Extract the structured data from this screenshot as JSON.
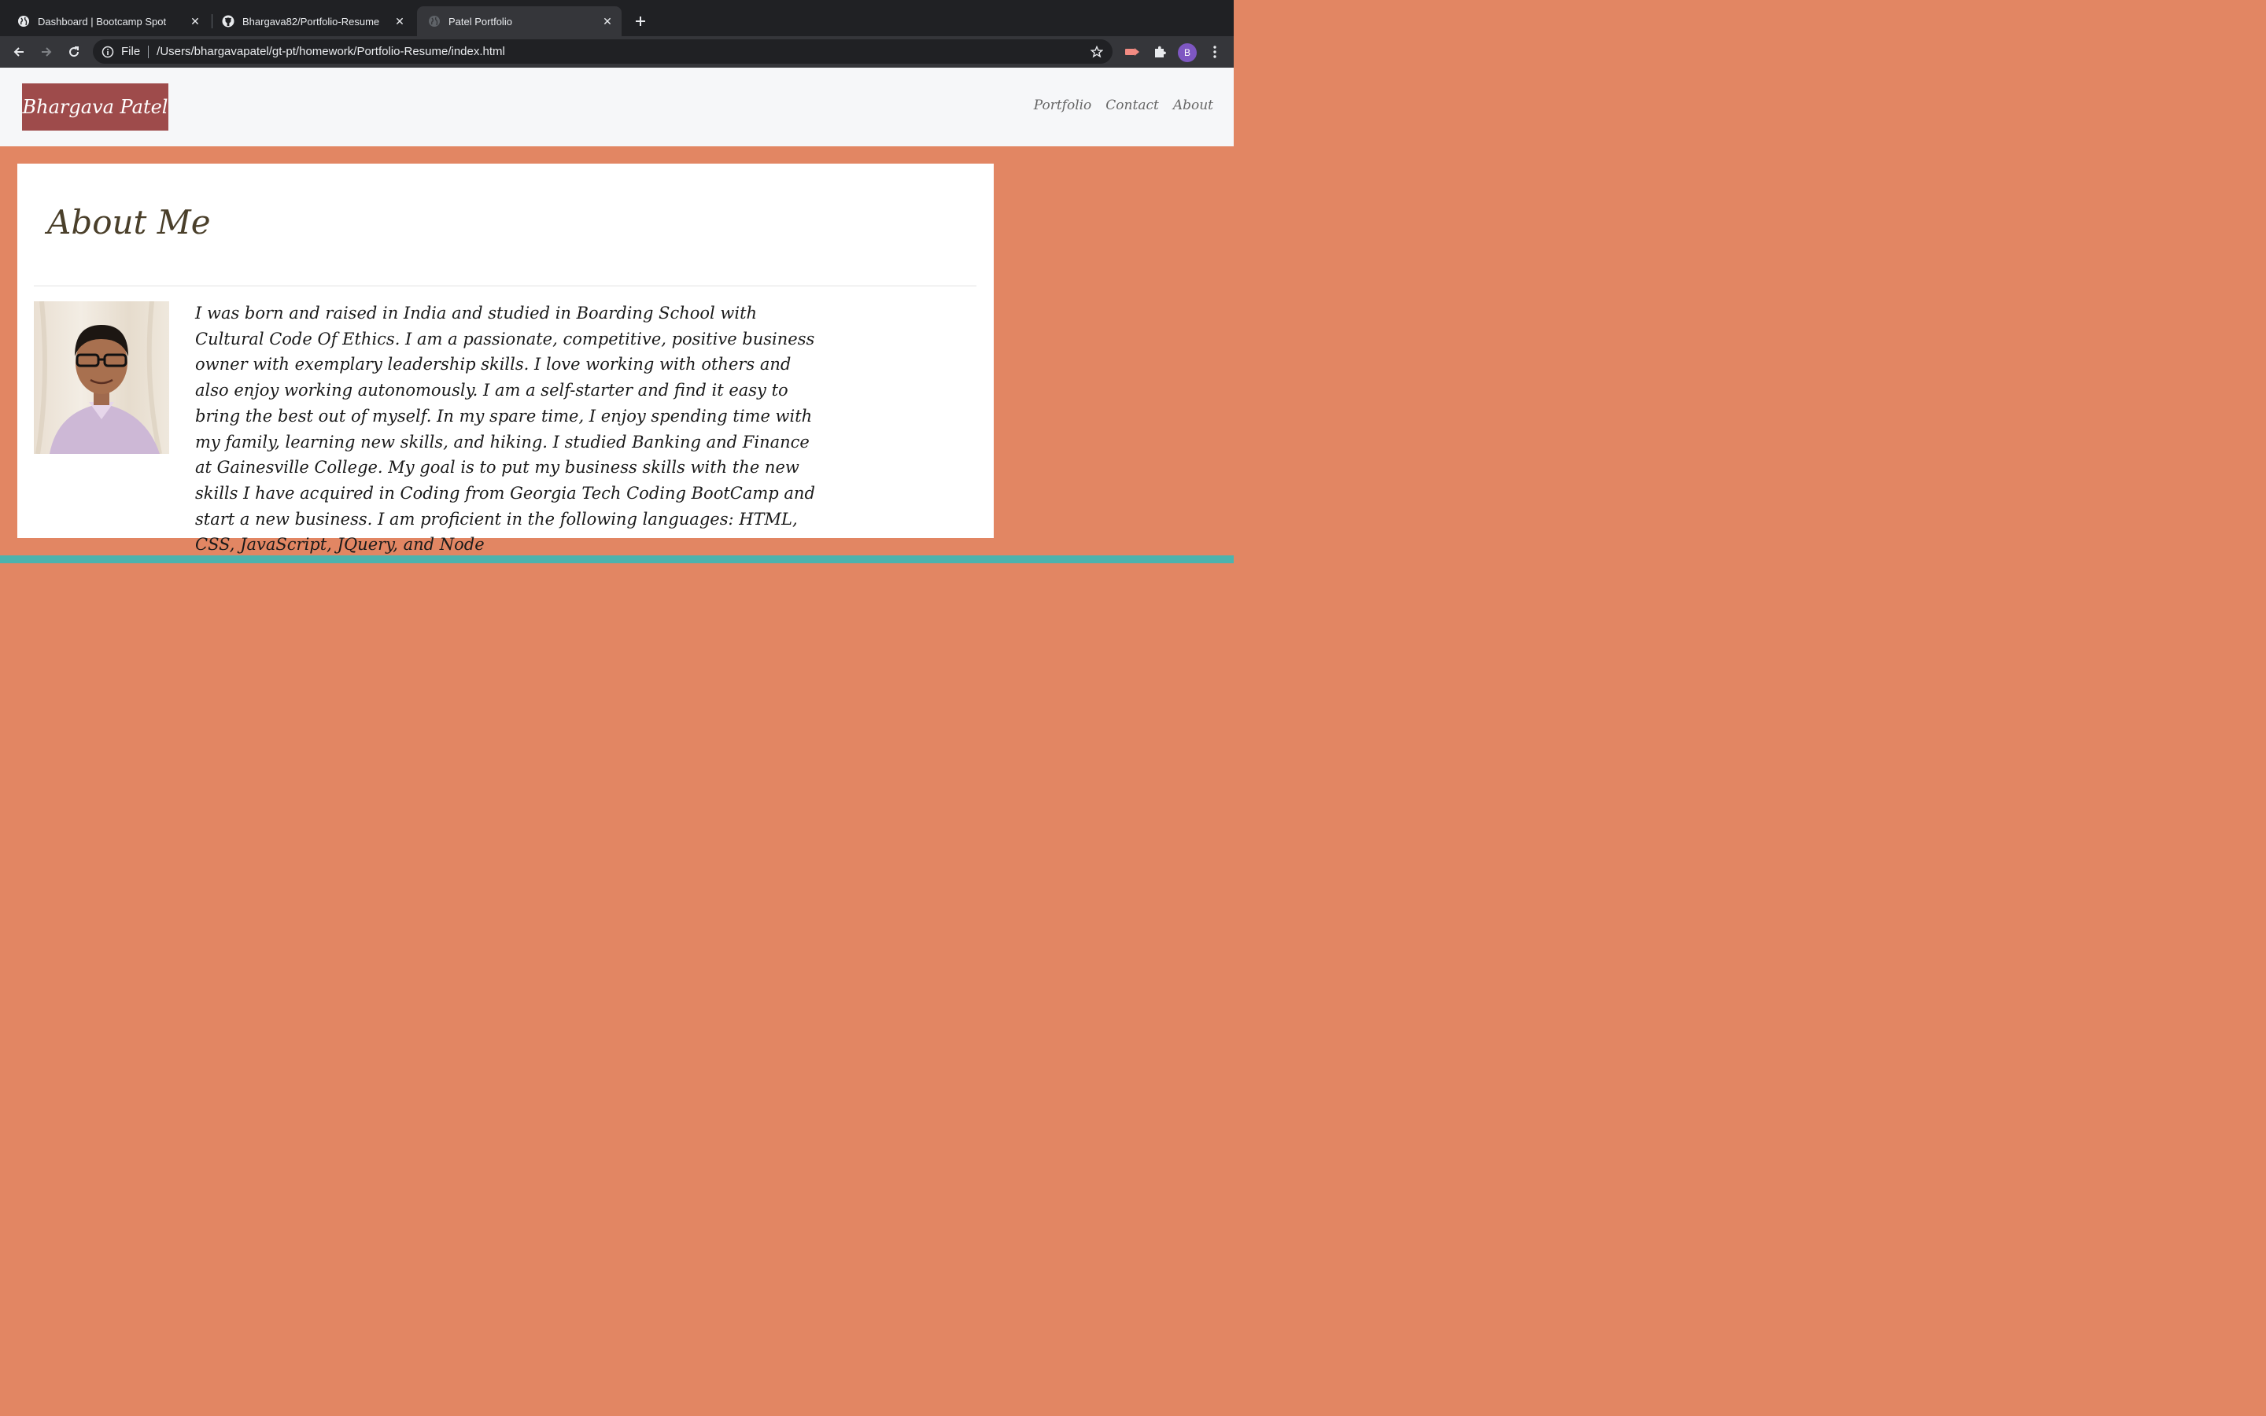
{
  "browser": {
    "tabs": [
      {
        "title": "Dashboard | Bootcamp Spot",
        "icon": "globe-icon"
      },
      {
        "title": "Bhargava82/Portfolio-Resume",
        "icon": "github-icon"
      },
      {
        "title": "Patel Portfolio",
        "icon": "globe-icon",
        "active": true
      }
    ],
    "address": {
      "scheme": "File",
      "url": "/Users/bhargavapatel/gt-pt/homework/Portfolio-Resume/index.html"
    },
    "profile_initial": "B"
  },
  "site": {
    "brand": "Bhargava Patel",
    "nav": [
      "Portfolio",
      "Contact",
      "About"
    ],
    "about": {
      "heading": "About Me",
      "bio": "I was born and raised in India and studied in Boarding School with Cultural Code Of Ethics. I am a passionate, competitive, positive business owner with exemplary leadership skills. I love working with others and also enjoy working autonomously. I am a self-starter and find it easy to bring the best out of myself. In my spare time, I enjoy spending time with my family, learning new skills, and hiking. I studied Banking and Finance at Gainesville College. My goal is to put my business skills with the new skills I have acquired in Coding from Georgia Tech Coding BootCamp and start a new business. I am proficient in the following languages: HTML, CSS, JavaScript, JQuery, and Node"
    }
  },
  "colors": {
    "page_bg": "#e28663",
    "header_bg": "#f6f7f9",
    "brand_bg": "#9e4b4b",
    "stripe": "#4cb3ad",
    "card_bg": "#ffffff"
  }
}
